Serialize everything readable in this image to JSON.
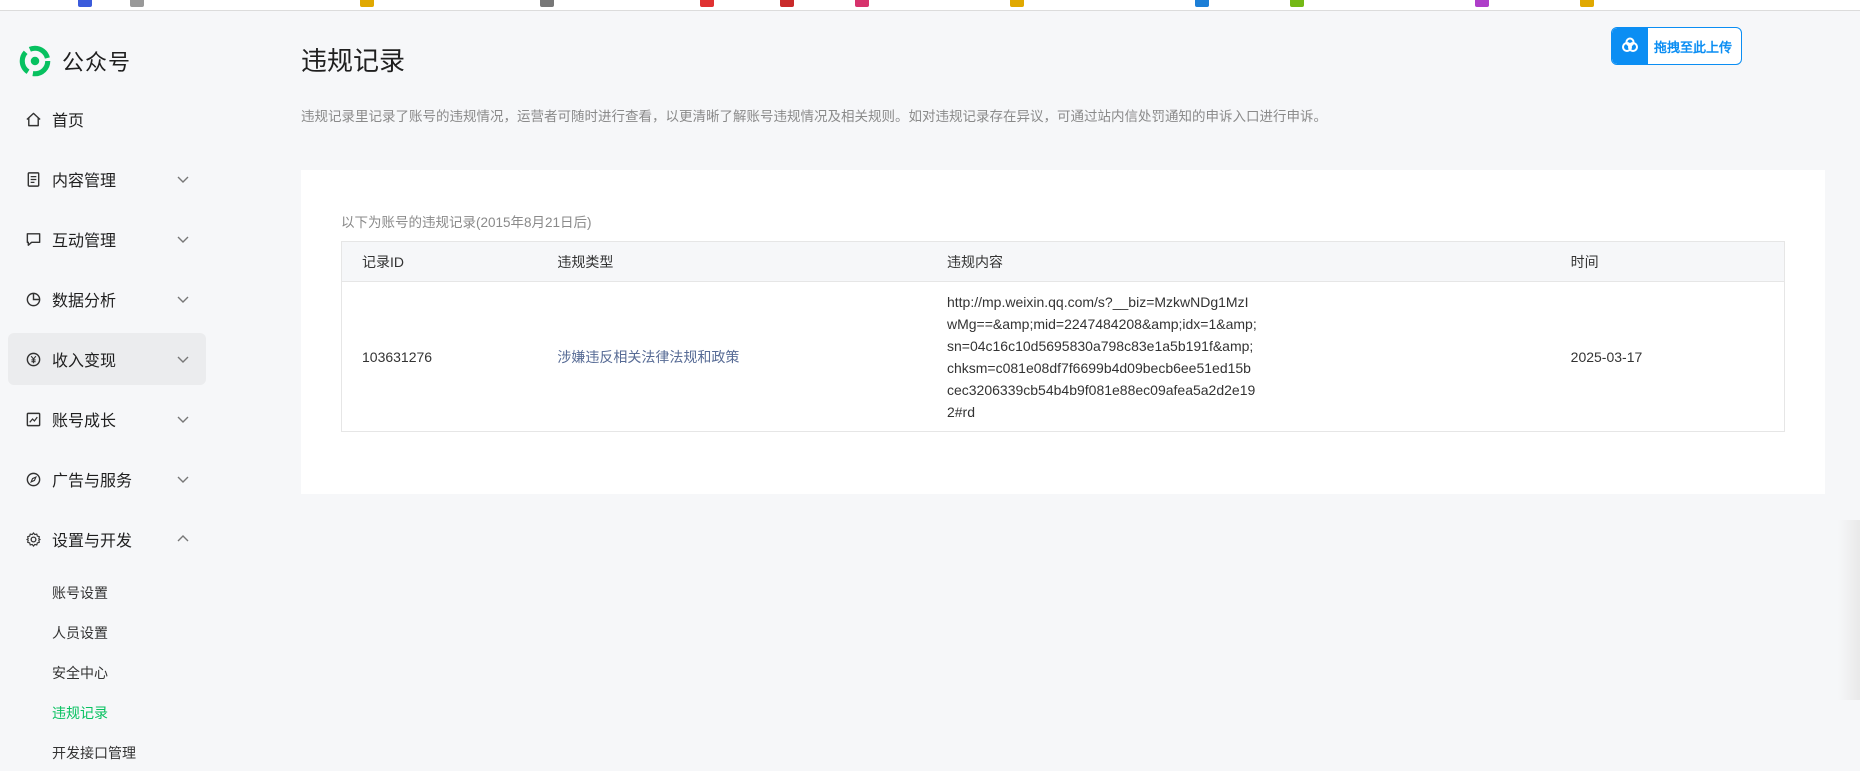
{
  "colors": {
    "accent_green": "#07c160",
    "link": "#576b95",
    "upload_blue": "#0b8ef3",
    "sidebar_bg": "#f6f7f9"
  },
  "brand": {
    "title": "公众号",
    "logo_icon": "wechat-official-account-logo"
  },
  "sidebar": {
    "items": [
      {
        "label": "首页",
        "icon": "home-icon",
        "has_chevron": false,
        "expanded": false
      },
      {
        "label": "内容管理",
        "icon": "document-icon",
        "has_chevron": true,
        "expanded": false
      },
      {
        "label": "互动管理",
        "icon": "comment-icon",
        "has_chevron": true,
        "expanded": false
      },
      {
        "label": "数据分析",
        "icon": "pie-chart-icon",
        "has_chevron": true,
        "expanded": false
      },
      {
        "label": "收入变现",
        "icon": "yuan-coin-icon",
        "has_chevron": true,
        "expanded": false,
        "highlighted": true
      },
      {
        "label": "账号成长",
        "icon": "growth-chart-icon",
        "has_chevron": true,
        "expanded": false
      },
      {
        "label": "广告与服务",
        "icon": "compass-icon",
        "has_chevron": true,
        "expanded": false
      },
      {
        "label": "设置与开发",
        "icon": "gear-icon",
        "has_chevron": true,
        "expanded": true
      }
    ],
    "sub_items": [
      {
        "label": "账号设置",
        "active": false
      },
      {
        "label": "人员设置",
        "active": false
      },
      {
        "label": "安全中心",
        "active": false
      },
      {
        "label": "违规记录",
        "active": true
      },
      {
        "label": "开发接口管理",
        "active": false
      }
    ]
  },
  "header": {
    "title": "违规记录",
    "description": "违规记录里记录了账号的违规情况，运营者可随时进行查看，以更清晰了解账号违规情况及相关规则。如对违规记录存在异议，可通过站内信处罚通知的申诉入口进行申诉。",
    "upload_button_label": "拖拽至此上传",
    "upload_icon": "cloud-upload-icon"
  },
  "records": {
    "caption": "以下为账号的违规记录(2015年8月21日后)",
    "columns": [
      "记录ID",
      "违规类型",
      "违规内容",
      "时间"
    ],
    "rows": [
      {
        "id": "103631276",
        "type": "涉嫌违反相关法律法规和政策",
        "content": "http://mp.weixin.qq.com/s?__biz=MzkwNDg1MzIwMg==&amp;mid=2247484208&amp;idx=1&amp;sn=04c16c10d5695830a798c83e1a5b191f&amp;chksm=c081e08df7f6699b4d09becb6ee51ed15bcec3206339cb54b4b9f081e88ec09afea5a2d2e192#rd",
        "time": "2025-03-17"
      }
    ]
  }
}
